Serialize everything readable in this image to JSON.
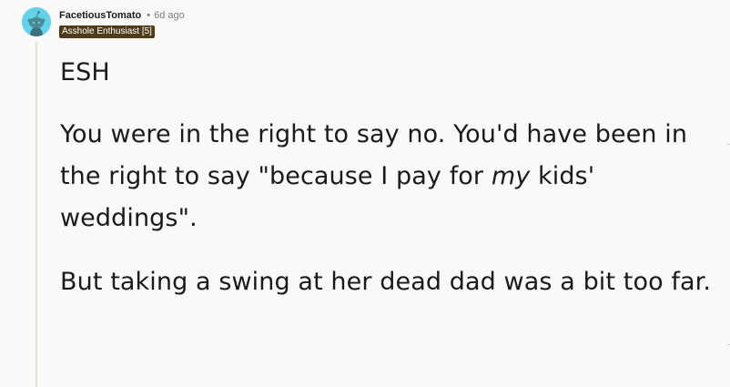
{
  "comment": {
    "author": "FacetiousTomato",
    "separator": "•",
    "time_ago": "6d ago",
    "flair": "Asshole Enthusiast [5]",
    "avatar_icon": "snoo-avatar-icon",
    "body": {
      "p1": "ESH",
      "p2_a": "You were in the right to say no. You'd have been in the right to say \"because I pay for ",
      "p2_em": "my",
      "p2_b": " kids' weddings\".",
      "p3": "But taking a swing at her dead dad was a bit too far."
    }
  },
  "colors": {
    "background": "#faf9f7",
    "avatar_bg": "#5fd3e8",
    "flair_bg": "#4d3b19",
    "flair_text": "#ffffff",
    "meta_text": "#7c7c7c"
  }
}
